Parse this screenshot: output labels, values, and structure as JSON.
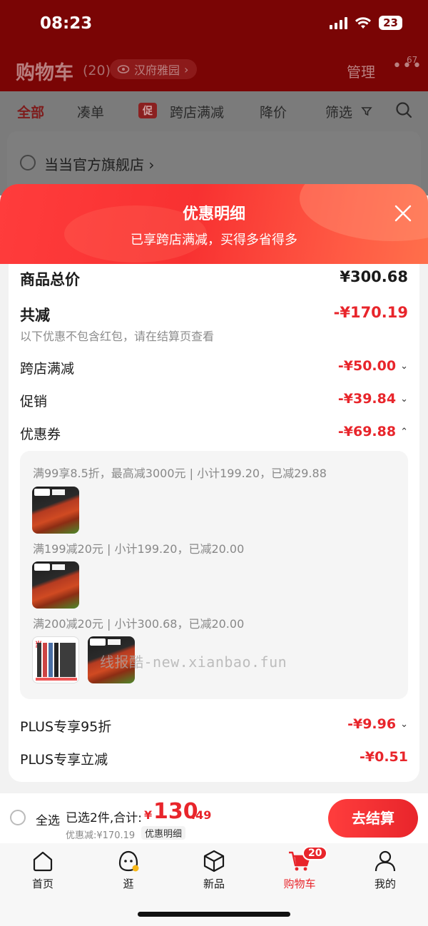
{
  "status_bar": {
    "time": "08:23",
    "battery": "23"
  },
  "header": {
    "title": "购物车",
    "count": "(20)",
    "location": "汉府雅园",
    "manage": "管理",
    "more_badge": "67"
  },
  "tabs": [
    {
      "label": "全部",
      "active": true
    },
    {
      "label": "凑单"
    },
    {
      "label": "跨店满减",
      "tag": "促"
    },
    {
      "label": "降价"
    },
    {
      "label": "筛选"
    }
  ],
  "store": {
    "name": "当当官方旗舰店"
  },
  "sheet": {
    "title": "优惠明细",
    "subtitle": "已享跨店满减，买得多省得多",
    "rows": {
      "goods_total": {
        "label": "商品总价",
        "value": "¥300.68"
      },
      "total_discount": {
        "label": "共减",
        "value": "-¥170.19"
      },
      "note": "以下优惠不包含红包，请在结算页查看",
      "cross_store": {
        "label": "跨店满减",
        "value": "-¥50.00"
      },
      "promotion": {
        "label": "促销",
        "value": "-¥39.84"
      },
      "coupon": {
        "label": "优惠券",
        "value": "-¥69.88"
      },
      "plus_discount": {
        "label": "PLUS专享95折",
        "value": "-¥9.96"
      },
      "plus_reduce": {
        "label": "PLUS专享立减",
        "value": "-¥0.51"
      }
    },
    "coupon_details": [
      {
        "text": "满99享8.5折，最高减3000元 | 小计199.20，已减29.88"
      },
      {
        "text": "满199减20元 | 小计199.20，已减20.00"
      },
      {
        "text": "满200减20元 | 小计300.68，已减20.00"
      }
    ]
  },
  "watermark": "线报酷-new.xianbao.fun",
  "checkout": {
    "select_all": "全选",
    "selected": "已选2件,合计:",
    "currency": "¥",
    "total_main": "130",
    "total_cents": ".49",
    "discount": "优惠减:¥170.19",
    "detail": "优惠明细",
    "button": "去结算"
  },
  "tabbar": [
    {
      "label": "首页",
      "icon": "home-icon"
    },
    {
      "label": "逛",
      "icon": "browse-icon"
    },
    {
      "label": "新品",
      "icon": "box-icon"
    },
    {
      "label": "购物车",
      "icon": "cart-icon",
      "badge": "20",
      "active": true
    },
    {
      "label": "我的",
      "icon": "profile-icon"
    }
  ],
  "colors": {
    "accent": "#e8252b",
    "header_dim": "#7a0505",
    "sheet_gradient": "#ff3c3c"
  }
}
